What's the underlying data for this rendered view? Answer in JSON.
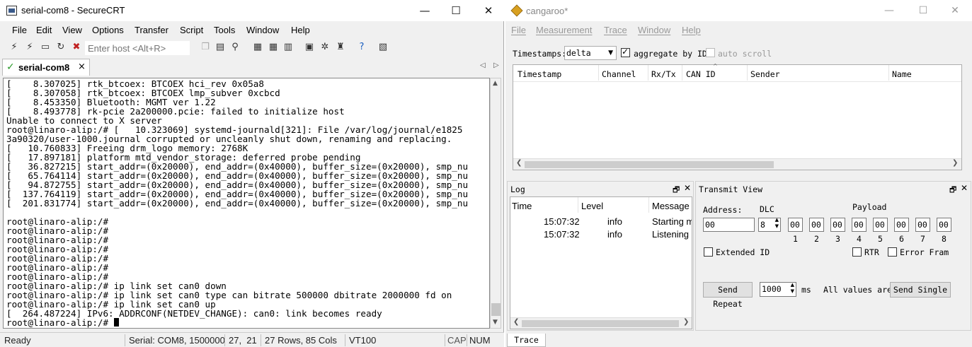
{
  "crt": {
    "title": "serial-com8 - SecureCRT",
    "window_buttons": {
      "minimize": "—",
      "maximize": "☐",
      "close": "✕"
    },
    "menu": [
      "File",
      "Edit",
      "View",
      "Options",
      "Transfer",
      "Script",
      "Tools",
      "Window",
      "Help"
    ],
    "host_placeholder": "Enter host <Alt+R>",
    "tab": {
      "label": "serial-com8",
      "close": "×"
    },
    "tab_nav": {
      "prev": "◁",
      "next": "▷"
    },
    "terminal_lines": [
      "[    8.307025] rtk_btcoex: BTCOEX hci_rev 0x05a8",
      "[    8.307058] rtk_btcoex: BTCOEX lmp_subver 0xcbcd",
      "[    8.453350] Bluetooth: MGMT ver 1.22",
      "[    8.493778] rk-pcie 2a200000.pcie: failed to initialize host",
      "Unable to connect to X server",
      "root@linaro-alip:/# [   10.323069] systemd-journald[321]: File /var/log/journal/e1825",
      "3a90320/user-1000.journal corrupted or uncleanly shut down, renaming and replacing.",
      "[   10.760833] Freeing drm_logo memory: 2768K",
      "[   17.897181] platform mtd_vendor_storage: deferred probe pending",
      "[   36.827215] start_addr=(0x20000), end_addr=(0x40000), buffer_size=(0x20000), smp_nu",
      "[   65.764114] start_addr=(0x20000), end_addr=(0x40000), buffer_size=(0x20000), smp_nu",
      "[   94.872755] start_addr=(0x20000), end_addr=(0x40000), buffer_size=(0x20000), smp_nu",
      "[  137.764119] start_addr=(0x20000), end_addr=(0x40000), buffer_size=(0x20000), smp_nu",
      "[  201.831774] start_addr=(0x20000), end_addr=(0x40000), buffer_size=(0x20000), smp_nu",
      "",
      "root@linaro-alip:/#",
      "root@linaro-alip:/#",
      "root@linaro-alip:/#",
      "root@linaro-alip:/#",
      "root@linaro-alip:/#",
      "root@linaro-alip:/#",
      "root@linaro-alip:/#",
      "root@linaro-alip:/# ip link set can0 down",
      "root@linaro-alip:/# ip link set can0 type can bitrate 500000 dbitrate 2000000 fd on",
      "root@linaro-alip:/# ip link set can0 up",
      "[  264.487224] IPv6: ADDRCONF(NETDEV_CHANGE): can0: link becomes ready",
      "root@linaro-alip:/# "
    ],
    "status": {
      "state": "Ready",
      "connection": "Serial: COM8, 1500000",
      "position": "27,  21",
      "size": "27 Rows, 85 Cols",
      "emulation": "VT100",
      "caps": "CAP",
      "num": "NUM"
    }
  },
  "cangaroo": {
    "title": "cangaroo*",
    "window_buttons": {
      "minimize": "—",
      "maximize": "☐",
      "close": "✕"
    },
    "menu": [
      "File",
      "Measurement",
      "Trace",
      "Window",
      "Help"
    ],
    "timestamps_label": "Timestamps:",
    "timestamps_value": "delta",
    "aggregate_label": "aggregate by ID",
    "aggregate_checked": true,
    "autoscroll_label": "auto scroll",
    "autoscroll_checked": false,
    "trace_columns": [
      "Timestamp",
      "Channel",
      "Rx/Tx",
      "CAN ID",
      "Sender",
      "Name"
    ],
    "log": {
      "title": "Log",
      "columns": [
        "Time",
        "Level",
        "Message"
      ],
      "rows": [
        {
          "time": "15:07:32",
          "level": "info",
          "message": "Starting m"
        },
        {
          "time": "15:07:32",
          "level": "info",
          "message": "Listening o"
        }
      ]
    },
    "transmit": {
      "title": "Transmit View",
      "address_label": "Address:",
      "address_value": "00",
      "dlc_label": "DLC",
      "dlc_value": "8",
      "payload_label": "Payload",
      "payload_values": [
        "00",
        "00",
        "00",
        "00",
        "00",
        "00",
        "00",
        "00"
      ],
      "payload_indices": [
        "1",
        "2",
        "3",
        "4",
        "5",
        "6",
        "7",
        "8"
      ],
      "extended_id_label": "Extended ID",
      "rtr_label": "RTR",
      "error_frame_label": "Error Fram",
      "send_repeat_label": "Send Repeat",
      "repeat_value": "1000",
      "ms_label": "ms",
      "all_values_label": "All values are h",
      "send_single_label": "Send Single"
    },
    "bottom_tab": "Trace"
  }
}
